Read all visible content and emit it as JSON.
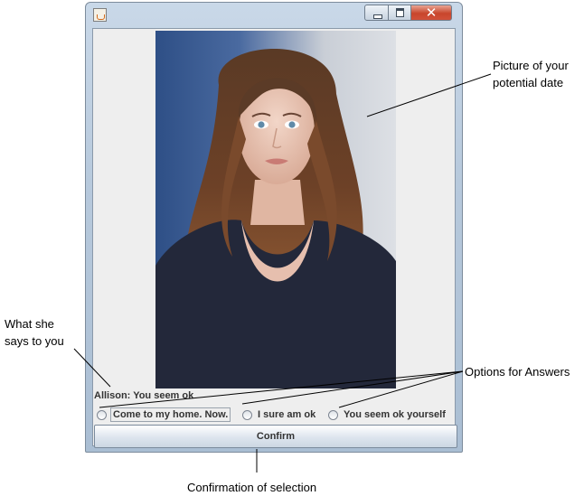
{
  "window": {
    "title": "",
    "controls": {
      "minimize": "minimize",
      "maximize": "maximize",
      "close": "✕"
    }
  },
  "dialogue": "Allison: You seem ok",
  "options": [
    {
      "label": "Come to my home. Now.",
      "selected": false
    },
    {
      "label": "I sure am ok",
      "selected": false
    },
    {
      "label": "You seem ok yourself",
      "selected": false
    }
  ],
  "confirm_label": "Confirm",
  "annotations": {
    "picture": "Picture of your potential date",
    "says": "What she says to you",
    "options": "Options for Answers",
    "confirm": "Confirmation of selection"
  },
  "colors": {
    "frame": "#b7c9dc",
    "panel": "#eeeeee",
    "close_button": "#c8462c"
  }
}
